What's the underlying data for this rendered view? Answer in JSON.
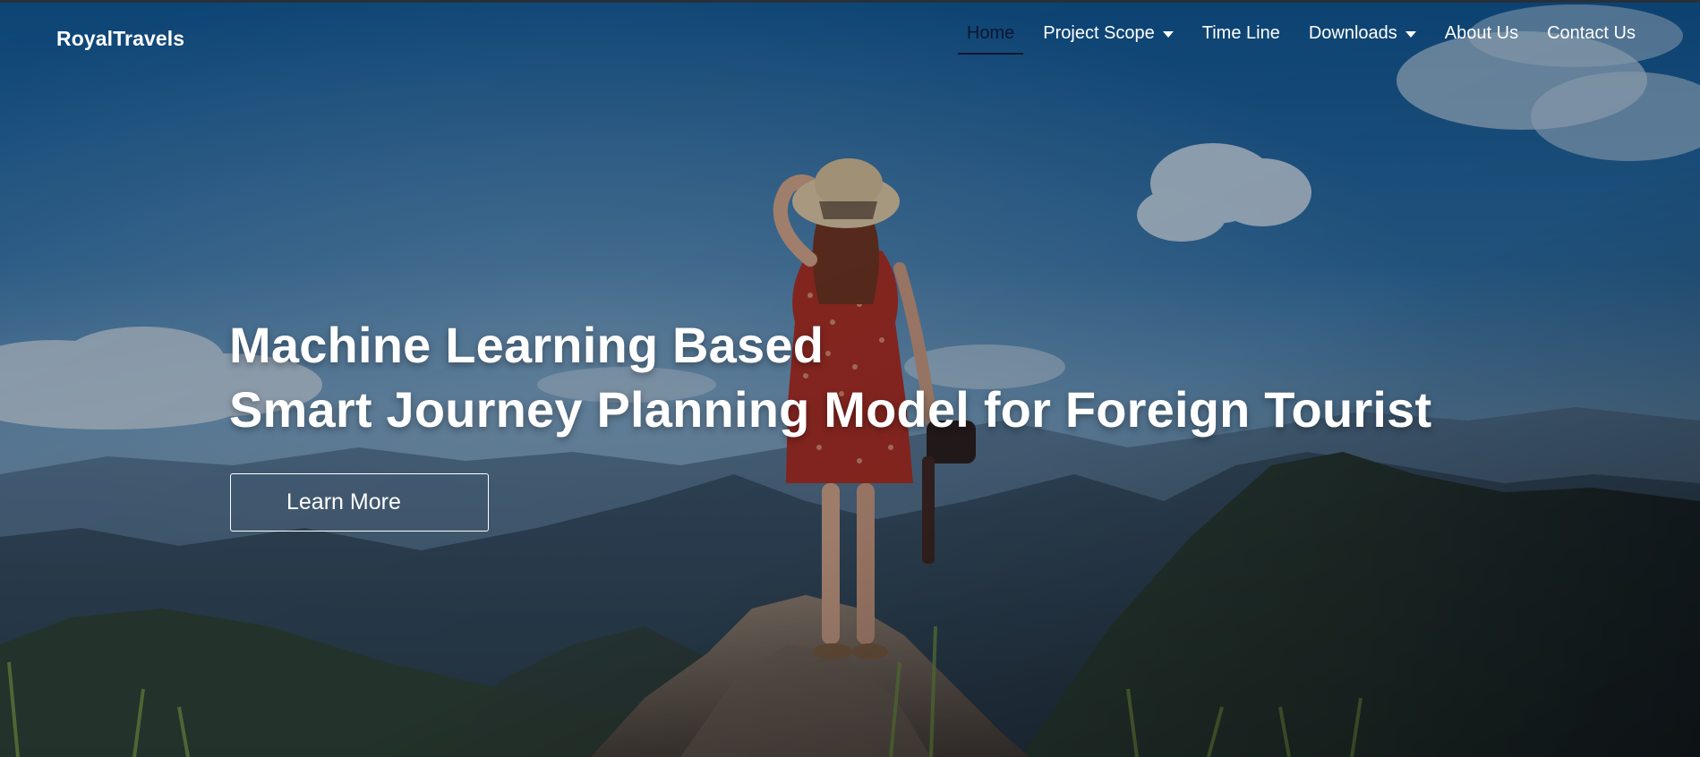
{
  "brand": {
    "name": "RoyalTravels"
  },
  "nav": {
    "items": [
      {
        "label": "Home",
        "active": true,
        "has_dropdown": false
      },
      {
        "label": "Project Scope",
        "active": false,
        "has_dropdown": true
      },
      {
        "label": "Time Line",
        "active": false,
        "has_dropdown": false
      },
      {
        "label": "Downloads",
        "active": false,
        "has_dropdown": true
      },
      {
        "label": "About Us",
        "active": false,
        "has_dropdown": false
      },
      {
        "label": "Contact Us",
        "active": false,
        "has_dropdown": false
      }
    ]
  },
  "hero": {
    "title_line1": "Machine Learning Based",
    "title_line2": "Smart Journey Planning Model for Foreign Tourist",
    "cta_label": "Learn More",
    "background_image": "woman-in-red-dress-on-mountain-peak-photo"
  },
  "colors": {
    "active_nav": "#0c1630",
    "text_light": "#ffffff",
    "sky_top": "#0f5289",
    "mountain_dark": "#1f2a33"
  }
}
